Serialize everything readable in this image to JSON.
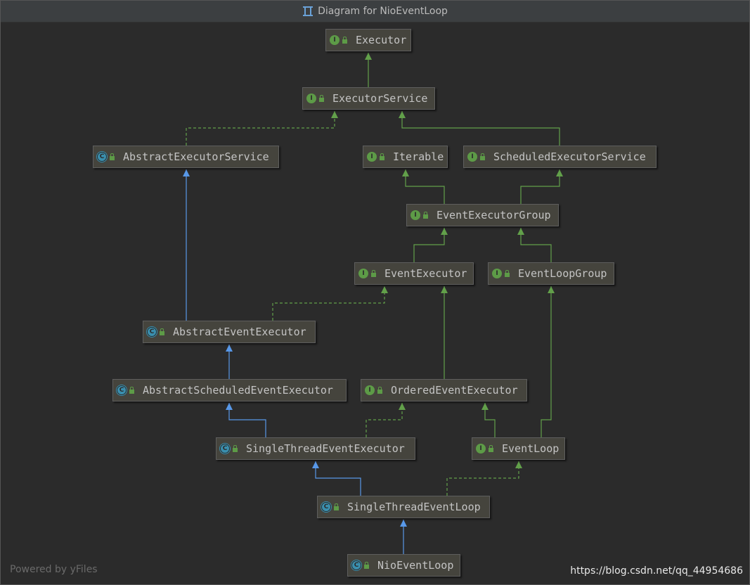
{
  "window": {
    "title": "Diagram for NioEventLoop"
  },
  "nodes": [
    {
      "id": "executor",
      "name": "Executor",
      "kind": "interface"
    },
    {
      "id": "executor_service",
      "name": "ExecutorService",
      "kind": "interface"
    },
    {
      "id": "abstract_executor_service",
      "name": "AbstractExecutorService",
      "kind": "abstract-class"
    },
    {
      "id": "iterable",
      "name": "Iterable",
      "kind": "interface"
    },
    {
      "id": "scheduled_executor_service",
      "name": "ScheduledExecutorService",
      "kind": "interface"
    },
    {
      "id": "event_executor_group",
      "name": "EventExecutorGroup",
      "kind": "interface"
    },
    {
      "id": "event_executor",
      "name": "EventExecutor",
      "kind": "interface"
    },
    {
      "id": "event_loop_group",
      "name": "EventLoopGroup",
      "kind": "interface"
    },
    {
      "id": "abstract_event_executor",
      "name": "AbstractEventExecutor",
      "kind": "abstract-class"
    },
    {
      "id": "abstract_scheduled_event_executor",
      "name": "AbstractScheduledEventExecutor",
      "kind": "abstract-class"
    },
    {
      "id": "ordered_event_executor",
      "name": "OrderedEventExecutor",
      "kind": "interface"
    },
    {
      "id": "single_thread_event_executor",
      "name": "SingleThreadEventExecutor",
      "kind": "abstract-class"
    },
    {
      "id": "event_loop",
      "name": "EventLoop",
      "kind": "interface"
    },
    {
      "id": "single_thread_event_loop",
      "name": "SingleThreadEventLoop",
      "kind": "abstract-class"
    },
    {
      "id": "nio_event_loop",
      "name": "NioEventLoop",
      "kind": "class"
    }
  ],
  "relations": [
    {
      "from": "executor_service",
      "to": "executor",
      "type": "extends-interface"
    },
    {
      "from": "abstract_executor_service",
      "to": "executor_service",
      "type": "implements"
    },
    {
      "from": "scheduled_executor_service",
      "to": "executor_service",
      "type": "extends-interface"
    },
    {
      "from": "event_executor_group",
      "to": "iterable",
      "type": "extends-interface"
    },
    {
      "from": "event_executor_group",
      "to": "scheduled_executor_service",
      "type": "extends-interface"
    },
    {
      "from": "event_executor",
      "to": "event_executor_group",
      "type": "extends-interface"
    },
    {
      "from": "event_loop_group",
      "to": "event_executor_group",
      "type": "extends-interface"
    },
    {
      "from": "abstract_event_executor",
      "to": "abstract_executor_service",
      "type": "extends-class"
    },
    {
      "from": "abstract_event_executor",
      "to": "event_executor",
      "type": "implements"
    },
    {
      "from": "abstract_scheduled_event_executor",
      "to": "abstract_event_executor",
      "type": "extends-class"
    },
    {
      "from": "ordered_event_executor",
      "to": "event_executor",
      "type": "extends-interface"
    },
    {
      "from": "single_thread_event_executor",
      "to": "abstract_scheduled_event_executor",
      "type": "extends-class"
    },
    {
      "from": "single_thread_event_executor",
      "to": "ordered_event_executor",
      "type": "implements"
    },
    {
      "from": "event_loop",
      "to": "ordered_event_executor",
      "type": "extends-interface"
    },
    {
      "from": "event_loop",
      "to": "event_loop_group",
      "type": "extends-interface"
    },
    {
      "from": "single_thread_event_loop",
      "to": "single_thread_event_executor",
      "type": "extends-class"
    },
    {
      "from": "single_thread_event_loop",
      "to": "event_loop",
      "type": "implements"
    },
    {
      "from": "nio_event_loop",
      "to": "single_thread_event_loop",
      "type": "extends-class"
    }
  ],
  "colors": {
    "interface_edge": "#62a04a",
    "class_edge": "#5898e8",
    "interface_icon": "#5d9b47",
    "class_icon": "#3a8fae"
  },
  "icons": {
    "interface": "I",
    "class": "C",
    "access": "lock-icon"
  },
  "footer": {
    "powered_by": "Powered by yFiles",
    "watermark": "https://blog.csdn.net/qq_44954686"
  }
}
